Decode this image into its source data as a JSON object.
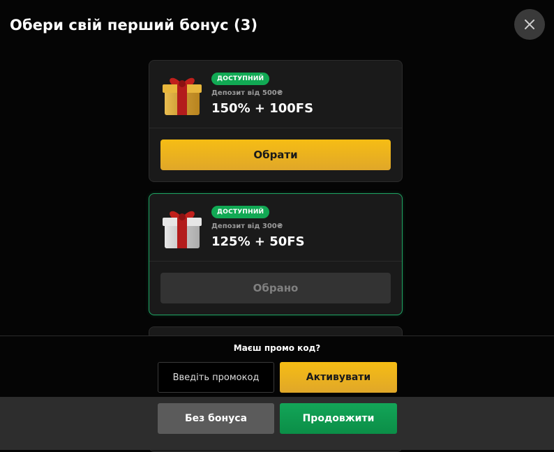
{
  "header": {
    "title": "Обери свій перший бонус (3)",
    "close_icon": "close-icon"
  },
  "bonuses": [
    {
      "badge": "ДОСТУПНИЙ",
      "deposit": "Депозит від 500₴",
      "offer": "150% + 100FS",
      "button": "Обрати",
      "gift_color": "gold",
      "selected": false
    },
    {
      "badge": "ДОСТУПНИЙ",
      "deposit": "Депозит від 300₴",
      "offer": "125% + 50FS",
      "button": "Обрано",
      "gift_color": "silver",
      "selected": true
    }
  ],
  "promo": {
    "question": "Маєш промо код?",
    "placeholder": "Введіть промокод",
    "activate_label": "Активувати"
  },
  "footer": {
    "no_bonus_label": "Без бонуса",
    "continue_label": "Продовжити"
  },
  "colors": {
    "accent_yellow": "#f6bd14",
    "badge_green": "#11a954",
    "continue_green": "#13a558",
    "selected_border": "#1fa463"
  }
}
